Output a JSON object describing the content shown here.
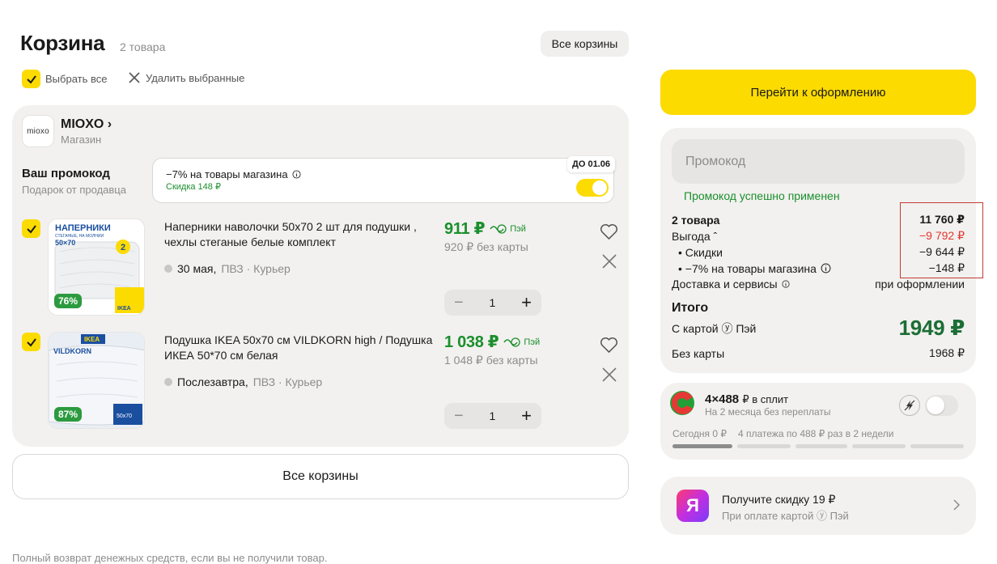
{
  "header": {
    "title": "Корзина",
    "count": "2 товара",
    "all_carts_label": "Все корзины",
    "select_all_label": "Выбрать все",
    "delete_selected_label": "Удалить выбранные"
  },
  "shop": {
    "logo_text": "mioxo",
    "name": "MIOXO ›",
    "type": "Магазин",
    "promo": {
      "title": "Ваш промокод",
      "subtitle": "Подарок от продавца",
      "description": "−7% на товары магазина",
      "discount": "Скидка 148 ₽",
      "badge": "ДО 01.06",
      "enabled": true
    }
  },
  "items": [
    {
      "title": "Наперники наволочки 50x70 2 шт для подушки , чехлы стеганые белые комплект",
      "price": "911 ₽",
      "pay_label": "Пэй",
      "old_price": "920 ₽ без карты",
      "delivery_date": "30 мая,",
      "delivery_methods": "ПВЗ · Курьер",
      "quantity": "1",
      "discount_badge": "76%",
      "image_text_top": "НАПЕРНИКИ",
      "image_text_sub": "СТЕГАНЫЕ, НА МОЛНИИ",
      "image_text_size": "50×70",
      "image_number": "2",
      "image_brand": "IKEA",
      "checked": true
    },
    {
      "title": "Подушка IKEA 50x70 см VILDKORN high / Подушка ИКЕА 50*70 см белая",
      "price": "1 038 ₽",
      "pay_label": "Пэй",
      "old_price": "1 048 ₽ без карты",
      "delivery_date": "Послезавтра,",
      "delivery_methods": "ПВЗ · Курьер",
      "quantity": "1",
      "discount_badge": "87%",
      "image_text_top": "IKEA",
      "image_text_sub": "VILDKORN",
      "image_text_size": "50x70",
      "checked": true
    }
  ],
  "all_carts_bottom_label": "Все корзины",
  "refund_note": "Полный возврат денежных средств, если вы не получили товар.",
  "summary": {
    "checkout_label": "Перейти к оформлению",
    "promo_placeholder": "Промокод",
    "promo_success": "Промокод успешно применен",
    "rows": {
      "items_label": "2 товара",
      "items_value": "11 760 ₽",
      "benefit_label": "Выгода ˆ",
      "benefit_value": "−9 792 ₽",
      "discounts_label": "• Скидки",
      "discounts_value": "−9 644 ₽",
      "shop_promo_label": "• −7% на товары магазина",
      "shop_promo_value": "−148 ₽",
      "delivery_label": "Доставка и сервисы",
      "delivery_value": "при оформлении"
    },
    "total_label": "Итого",
    "with_card_label": "С картой ⓨ Пэй",
    "with_card_value": "1949 ₽",
    "without_card_label": "Без карты",
    "without_card_value": "1968 ₽"
  },
  "split": {
    "main": "4×488",
    "main_suffix": "₽ в сплит",
    "sub": "На 2 месяца без переплаты",
    "today": "Сегодня 0 ₽",
    "schedule": "4 платежа по 488 ₽ раз в 2 недели",
    "enabled": false
  },
  "bonus": {
    "logo_letter": "Я",
    "title": "Получите скидку 19 ₽",
    "subtitle": "При оплате картой ⓨ Пэй"
  },
  "colors": {
    "accent_yellow": "#fcdb00",
    "price_green": "#1b8f2d",
    "benefit_red": "#e5352d",
    "card_bg": "#f2f1ef"
  }
}
